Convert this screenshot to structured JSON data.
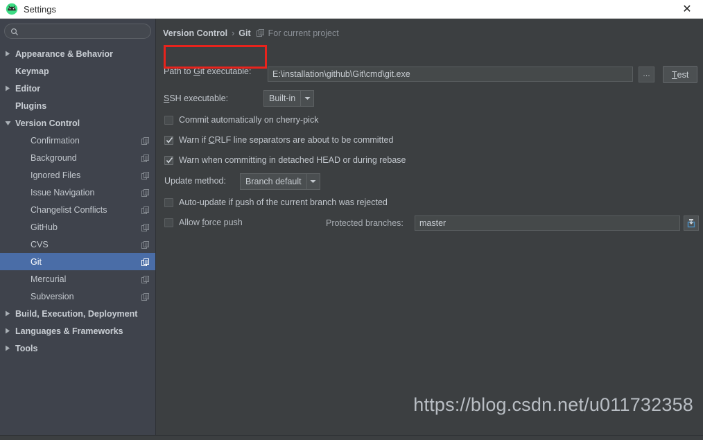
{
  "window": {
    "title": "Settings",
    "app_icon": "android-studio-icon",
    "close_label": "✕"
  },
  "sidebar": {
    "search": {
      "value": "",
      "placeholder": "",
      "icon": "search-icon"
    },
    "items": [
      {
        "label": "Appearance & Behavior",
        "level": 0,
        "arrow": "right",
        "scope_icon": false,
        "selected": false
      },
      {
        "label": "Keymap",
        "level": 0,
        "arrow": "none",
        "scope_icon": false,
        "selected": false
      },
      {
        "label": "Editor",
        "level": 0,
        "arrow": "right",
        "scope_icon": false,
        "selected": false
      },
      {
        "label": "Plugins",
        "level": 0,
        "arrow": "none",
        "scope_icon": false,
        "selected": false
      },
      {
        "label": "Version Control",
        "level": 0,
        "arrow": "down",
        "scope_icon": false,
        "selected": false
      },
      {
        "label": "Confirmation",
        "level": 1,
        "arrow": "none",
        "scope_icon": true,
        "selected": false
      },
      {
        "label": "Background",
        "level": 1,
        "arrow": "none",
        "scope_icon": true,
        "selected": false
      },
      {
        "label": "Ignored Files",
        "level": 1,
        "arrow": "none",
        "scope_icon": true,
        "selected": false
      },
      {
        "label": "Issue Navigation",
        "level": 1,
        "arrow": "none",
        "scope_icon": true,
        "selected": false
      },
      {
        "label": "Changelist Conflicts",
        "level": 1,
        "arrow": "none",
        "scope_icon": true,
        "selected": false
      },
      {
        "label": "GitHub",
        "level": 1,
        "arrow": "none",
        "scope_icon": true,
        "selected": false
      },
      {
        "label": "CVS",
        "level": 1,
        "arrow": "none",
        "scope_icon": true,
        "selected": false
      },
      {
        "label": "Git",
        "level": 1,
        "arrow": "none",
        "scope_icon": true,
        "selected": true
      },
      {
        "label": "Mercurial",
        "level": 1,
        "arrow": "none",
        "scope_icon": true,
        "selected": false
      },
      {
        "label": "Subversion",
        "level": 1,
        "arrow": "none",
        "scope_icon": true,
        "selected": false
      },
      {
        "label": "Build, Execution, Deployment",
        "level": 0,
        "arrow": "right",
        "scope_icon": false,
        "selected": false
      },
      {
        "label": "Languages & Frameworks",
        "level": 0,
        "arrow": "right",
        "scope_icon": false,
        "selected": false
      },
      {
        "label": "Tools",
        "level": 0,
        "arrow": "right",
        "scope_icon": false,
        "selected": false
      }
    ],
    "selected_index": 12
  },
  "breadcrumb": {
    "root": "Version Control",
    "separator": "›",
    "current": "Git",
    "scope_icon": "project-scope-icon",
    "scope_text": "For current project"
  },
  "main": {
    "git_path": {
      "label_prefix": "Path to ",
      "label_mnemonic": "G",
      "label_suffix": "it executable:",
      "value": "E:\\installation\\github\\Git\\cmd\\git.exe",
      "browse_label": "…",
      "test_mnemonic": "T",
      "test_rest": "est"
    },
    "ssh": {
      "label_mnemonic": "S",
      "label_rest": "SH executable:",
      "value": "Built-in"
    },
    "checkboxes": [
      {
        "label": "Commit automatically on cherry-pick",
        "checked": false
      },
      {
        "label_pre": "Warn if ",
        "label_mn": "C",
        "label_post": "RLF line separators are about to be committed",
        "checked": true
      },
      {
        "label": "Warn when committing in detached HEAD or during rebase",
        "checked": true
      },
      {
        "label_pre": "Auto-update if ",
        "label_mn": "p",
        "label_post": "ush of the current branch was rejected",
        "checked": false
      },
      {
        "label_pre": "Allow ",
        "label_mn": "f",
        "label_post": "orce push",
        "checked": false
      }
    ],
    "update_method": {
      "label": "Update method:",
      "value": "Branch default"
    },
    "protected_branches": {
      "label": "Protected branches:",
      "value": "master",
      "expand_icon": "expand-editor-icon"
    }
  },
  "annotation": {
    "highlight_color": "#e8231c",
    "target": "path-to-git-executable-label"
  },
  "watermark": {
    "text": "https://blog.csdn.net/u011732358"
  }
}
